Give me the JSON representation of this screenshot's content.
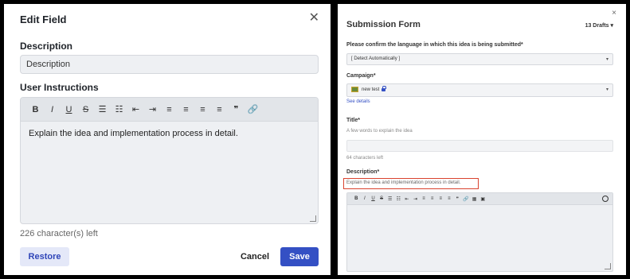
{
  "left": {
    "title": "Edit Field",
    "close": "✕",
    "description_label": "Description",
    "description_value": "Description",
    "instructions_label": "User Instructions",
    "toolbar": [
      "B",
      "I",
      "U",
      "S",
      "☰",
      "☷",
      "⇤",
      "⇥",
      "≡",
      "≡",
      "≡",
      "≡",
      "❞",
      "🔗"
    ],
    "editor_text": "Explain the idea and implementation process in detail.",
    "chars_left": "226 character(s) left",
    "restore_label": "Restore",
    "cancel_label": "Cancel",
    "save_label": "Save"
  },
  "right": {
    "close": "×",
    "title": "Submission Form",
    "drafts": "13 Drafts ▾",
    "language_label": "Please confirm the language in which this idea is being submitted",
    "language_value": "[ Detect Automatically ]",
    "campaign_label": "Campaign",
    "campaign_value": "new test",
    "see_details": "See details",
    "title_label": "Title",
    "title_hint": "A few words to explain the idea",
    "title_chars": "64 characters left",
    "description_label": "Description",
    "description_hint": "Explain the idea and implementation process in detail.",
    "toolbar": [
      "B",
      "I",
      "U",
      "S",
      "☰",
      "☷",
      "⇤",
      "⇥",
      "≡",
      "≡",
      "≡",
      "≡",
      "❞",
      "🔗",
      "▦",
      "▣"
    ],
    "required_mark": "*"
  },
  "colors": {
    "primary": "#3450c4",
    "highlight": "#d9432f"
  }
}
